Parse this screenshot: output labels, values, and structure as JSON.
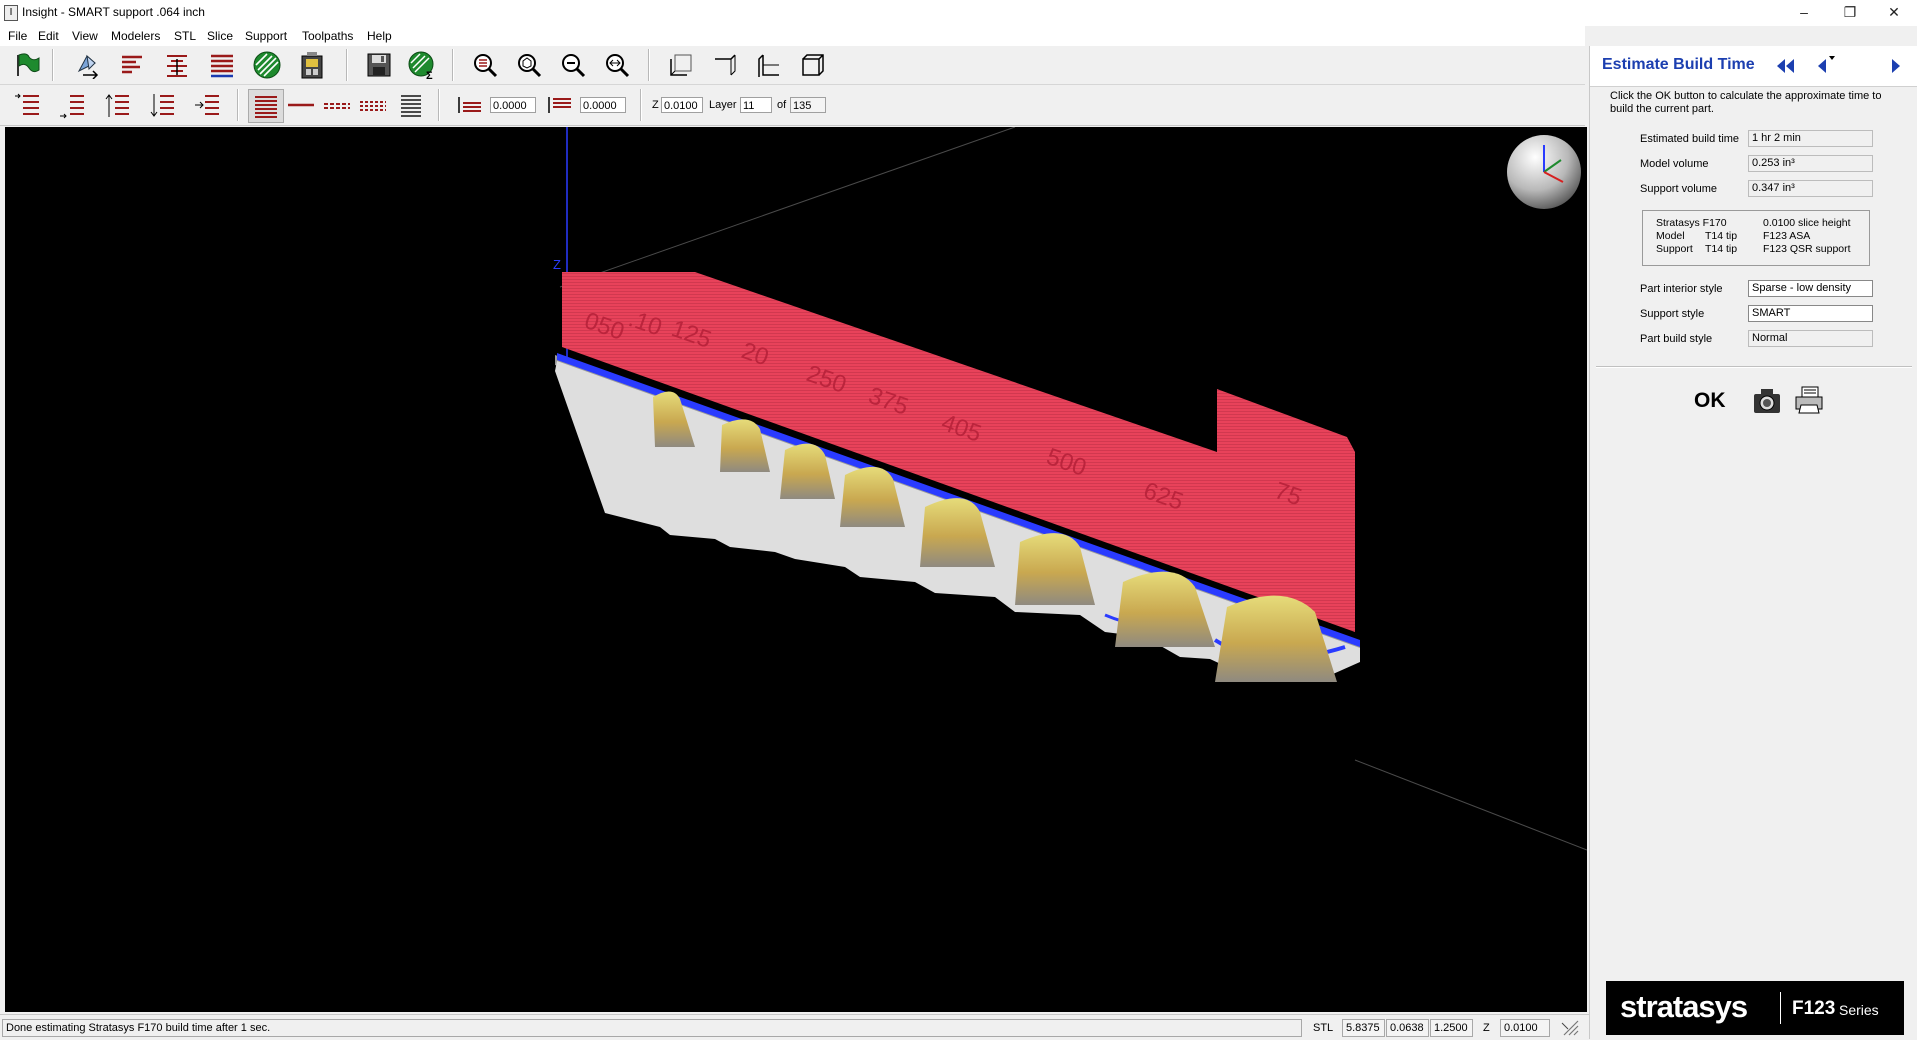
{
  "window": {
    "title": "Insight - SMART support .064 inch"
  },
  "menu": [
    "File",
    "Edit",
    "View",
    "Modelers",
    "STL",
    "Slice",
    "Support",
    "Toolpaths",
    "Help"
  ],
  "toolbar2": {
    "field1": "0.0000",
    "field2": "0.0000",
    "z_label": "Z",
    "z_value": "0.0100",
    "layer_label": "Layer",
    "layer_value": "11",
    "of_label": "of",
    "of_value": "135"
  },
  "viewport": {
    "axis_label": "Z",
    "part_labels": [
      "050",
      ".10",
      "125",
      "20",
      "250",
      "375",
      "405",
      "500",
      "625",
      "75"
    ],
    "colors": {
      "background": "#000000",
      "model": "#e8425a",
      "support": "#d9cc60",
      "base": "#2a3bff"
    }
  },
  "panel": {
    "title": "Estimate Build Time",
    "help_text": "Click the OK button to calculate the approximate time to build the current part.",
    "estimated_build_time_label": "Estimated build time",
    "estimated_build_time": "1 hr 2 min",
    "model_volume_label": "Model volume",
    "model_volume": "0.253 in³",
    "support_volume_label": "Support volume",
    "support_volume": "0.347 in³",
    "info": {
      "printer": "Stratasys F170",
      "slice": "0.0100 slice height",
      "model_label": "Model",
      "model_tip": "T14 tip",
      "model_material": "F123 ASA",
      "support_label": "Support",
      "support_tip": "T14 tip",
      "support_material": "F123 QSR support"
    },
    "part_interior_style_label": "Part interior style",
    "part_interior_style": "Sparse - low density",
    "support_style_label": "Support style",
    "support_style": "SMART",
    "part_build_style_label": "Part build style",
    "part_build_style": "Normal",
    "ok_label": "OK",
    "logo_brand": "stratasys",
    "logo_series_prefix": "F123",
    "logo_series": "Series"
  },
  "status": {
    "message": "Done estimating Stratasys F170 build time after 1 sec.",
    "stl_label": "STL",
    "x": "5.8375",
    "y": "0.0638",
    "zsize": "1.2500",
    "z_label": "Z",
    "z": "0.0100"
  }
}
